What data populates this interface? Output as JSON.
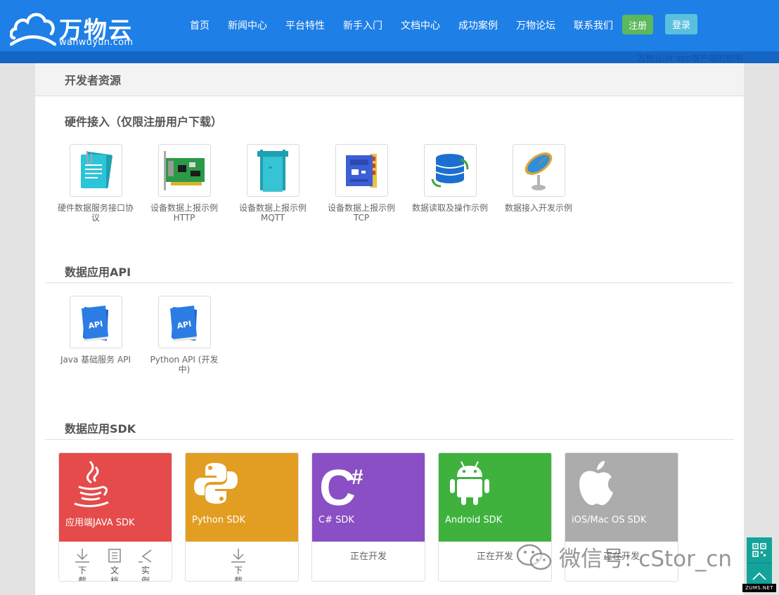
{
  "brand": {
    "name_cn": "万物云",
    "domain": "wanwuyun.com"
  },
  "nav": {
    "items": [
      "首页",
      "新闻中心",
      "平台特性",
      "新手入门",
      "文档中心",
      "成功案例",
      "万物论坛",
      "联系我们"
    ],
    "register": "注册",
    "login": "登录"
  },
  "marquee": "万物云iot app客户端的说明",
  "page": {
    "title": "开发者资源"
  },
  "hardware": {
    "title": "硬件接入（仅限注册用户下载）",
    "items": [
      {
        "label": "硬件数据服务接口协议",
        "icon": "document-icon"
      },
      {
        "label": "设备数据上报示例HTTP",
        "icon": "network-card-icon"
      },
      {
        "label": "设备数据上报示例MQTT",
        "icon": "device-icon"
      },
      {
        "label": "设备数据上报示例TCP",
        "icon": "chip-board-icon"
      },
      {
        "label": "数据读取及操作示例",
        "icon": "database-icon"
      },
      {
        "label": "数据接入开发示例",
        "icon": "satellite-dish-icon"
      }
    ]
  },
  "api": {
    "title": "数据应用API",
    "items": [
      {
        "label": "Java 基础服务 API",
        "icon": "api-book-icon",
        "badge": "API"
      },
      {
        "label": "Python API (开发中)",
        "icon": "api-book-icon",
        "badge": "API"
      }
    ]
  },
  "sdk": {
    "title": "数据应用SDK",
    "cards": [
      {
        "name": "应用端JAVA SDK",
        "color": "#e54b4b",
        "icon": "java-icon",
        "actions": [
          {
            "label": "下载",
            "icon": "download-icon"
          },
          {
            "label": "文档",
            "icon": "doc-icon"
          },
          {
            "label": "实例",
            "icon": "example-icon"
          }
        ]
      },
      {
        "name": "Python SDK",
        "color": "#e29e22",
        "icon": "python-icon",
        "actions": [
          {
            "label": "下载",
            "icon": "download-icon"
          }
        ]
      },
      {
        "name": "C# SDK",
        "color": "#8a4fc4",
        "icon": "csharp-icon",
        "letter": "C",
        "mark": "#",
        "status": "正在开发"
      },
      {
        "name": "Android SDK",
        "color": "#3fb23d",
        "icon": "android-icon",
        "status": "正在开发"
      },
      {
        "name": "iOS/Mac OS SDK",
        "color": "#acacac",
        "icon": "apple-icon",
        "status": "正在开发"
      }
    ]
  },
  "watermark": "微信号: cStor_cn",
  "site_tag": "ZUMS.NET",
  "colors": {
    "header": "#1e7fe6",
    "header_strip": "#1566c4",
    "register": "#5cb85c",
    "login": "#5bc0de",
    "side_widget": "#14a39a"
  }
}
